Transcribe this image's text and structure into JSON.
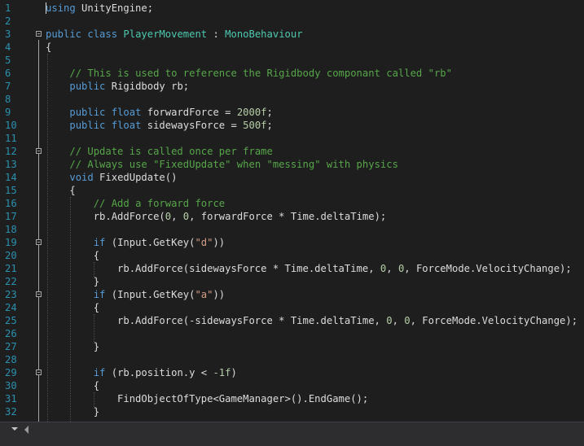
{
  "editor": {
    "line_numbers": [
      "1",
      "2",
      "3",
      "4",
      "5",
      "6",
      "7",
      "8",
      "9",
      "10",
      "11",
      "12",
      "13",
      "14",
      "15",
      "16",
      "17",
      "18",
      "19",
      "20",
      "21",
      "22",
      "23",
      "24",
      "25",
      "26",
      "27",
      "28",
      "29",
      "30",
      "31",
      "32"
    ],
    "lines": [
      [
        {
          "t": "using",
          "c": "kw"
        },
        {
          "t": " UnityEngine;"
        }
      ],
      [],
      [
        {
          "t": "public",
          "c": "kw"
        },
        {
          "t": " "
        },
        {
          "t": "class",
          "c": "kw"
        },
        {
          "t": " "
        },
        {
          "t": "PlayerMovement",
          "c": "ty"
        },
        {
          "t": " : "
        },
        {
          "t": "MonoBehaviour",
          "c": "ty"
        }
      ],
      [
        {
          "t": "{"
        }
      ],
      [],
      [
        {
          "t": "    "
        },
        {
          "t": "// This is used to reference the Rigidbody componant called \"rb\"",
          "c": "cm"
        }
      ],
      [
        {
          "t": "    "
        },
        {
          "t": "public",
          "c": "kw"
        },
        {
          "t": " Rigidbody rb;"
        }
      ],
      [],
      [
        {
          "t": "    "
        },
        {
          "t": "public",
          "c": "kw"
        },
        {
          "t": " "
        },
        {
          "t": "float",
          "c": "kw"
        },
        {
          "t": " forwardForce = "
        },
        {
          "t": "2000f",
          "c": "nm"
        },
        {
          "t": ";"
        }
      ],
      [
        {
          "t": "    "
        },
        {
          "t": "public",
          "c": "kw"
        },
        {
          "t": " "
        },
        {
          "t": "float",
          "c": "kw"
        },
        {
          "t": " sidewaysForce = "
        },
        {
          "t": "500f",
          "c": "nm"
        },
        {
          "t": ";"
        }
      ],
      [],
      [
        {
          "t": "    "
        },
        {
          "t": "// Update is called once per frame",
          "c": "cm"
        }
      ],
      [
        {
          "t": "    "
        },
        {
          "t": "// Always use \"FixedUpdate\" when \"messing\" with physics",
          "c": "cm"
        }
      ],
      [
        {
          "t": "    "
        },
        {
          "t": "void",
          "c": "kw"
        },
        {
          "t": " FixedUpdate()"
        }
      ],
      [
        {
          "t": "    {"
        }
      ],
      [
        {
          "t": "        "
        },
        {
          "t": "// Add a forward force",
          "c": "cm"
        }
      ],
      [
        {
          "t": "        rb.AddForce("
        },
        {
          "t": "0",
          "c": "nm"
        },
        {
          "t": ", "
        },
        {
          "t": "0",
          "c": "nm"
        },
        {
          "t": ", forwardForce * Time.deltaTime);"
        }
      ],
      [],
      [
        {
          "t": "        "
        },
        {
          "t": "if",
          "c": "kw"
        },
        {
          "t": " (Input.GetKey("
        },
        {
          "t": "\"d\"",
          "c": "st"
        },
        {
          "t": "))"
        }
      ],
      [
        {
          "t": "        {"
        }
      ],
      [
        {
          "t": "            rb.AddForce(sidewaysForce * Time.deltaTime, "
        },
        {
          "t": "0",
          "c": "nm"
        },
        {
          "t": ", "
        },
        {
          "t": "0",
          "c": "nm"
        },
        {
          "t": ", ForceMode.VelocityChange);"
        }
      ],
      [
        {
          "t": "        }"
        }
      ],
      [
        {
          "t": "        "
        },
        {
          "t": "if",
          "c": "kw"
        },
        {
          "t": " (Input.GetKey("
        },
        {
          "t": "\"a\"",
          "c": "st"
        },
        {
          "t": "))"
        }
      ],
      [
        {
          "t": "        {"
        }
      ],
      [
        {
          "t": "            rb.AddForce(-sidewaysForce * Time.deltaTime, "
        },
        {
          "t": "0",
          "c": "nm"
        },
        {
          "t": ", "
        },
        {
          "t": "0",
          "c": "nm"
        },
        {
          "t": ", ForceMode.VelocityChange);"
        }
      ],
      [],
      [
        {
          "t": "        }"
        }
      ],
      [],
      [
        {
          "t": "        "
        },
        {
          "t": "if",
          "c": "kw"
        },
        {
          "t": " (rb.position.y < "
        },
        {
          "t": "-1f",
          "c": "nm"
        },
        {
          "t": ")"
        }
      ],
      [
        {
          "t": "        {"
        }
      ],
      [
        {
          "t": "            FindObjectOfType<GameManager>().EndGame();"
        }
      ],
      [
        {
          "t": "        }"
        }
      ]
    ]
  },
  "colors": {
    "background": "#1e1e1e",
    "keyword": "#569cd6",
    "type": "#4ec9b0",
    "comment": "#57a64a",
    "string": "#d69d85",
    "number": "#b5cea8",
    "line_number": "#2b91af"
  },
  "icons": {
    "fold_marker": "minus-box-icon",
    "scroll_left": "arrow-left-icon",
    "zoom_dropdown": "chevron-down-icon"
  }
}
